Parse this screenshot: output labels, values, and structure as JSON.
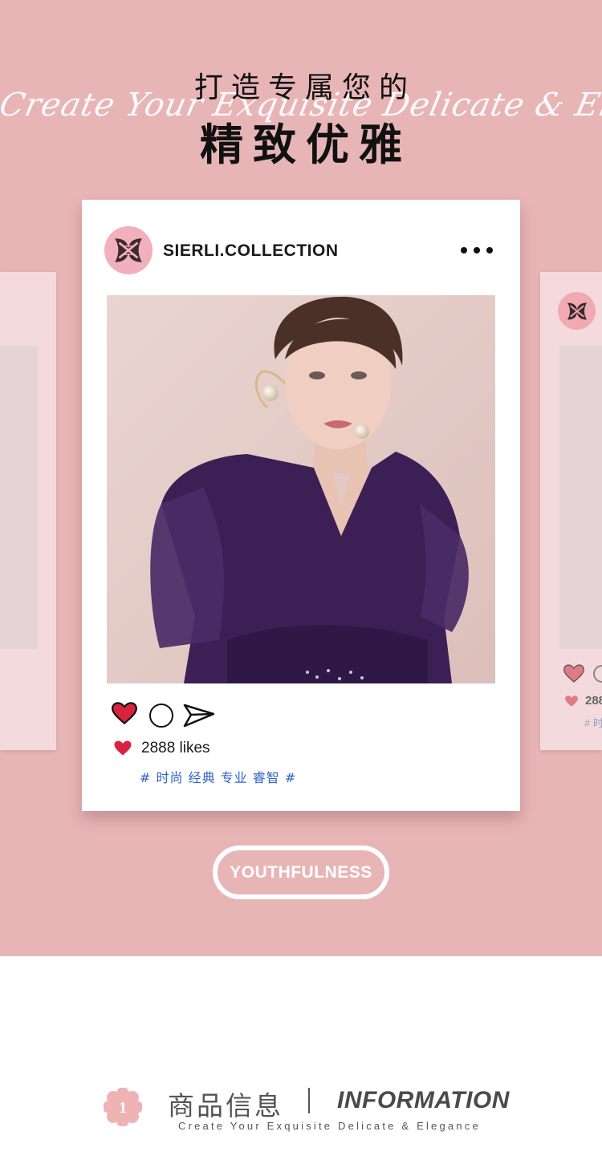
{
  "hero": {
    "script_text": "Create Your Exquisite Delicate & Elegance",
    "headline_line1": "打造专属您的",
    "headline_line2": "精致优雅"
  },
  "post": {
    "account_name": "SIERLI.COLLECTION",
    "likes_text": "2888 likes",
    "hashtags": "# 时尚 经典 专业 睿智 #",
    "actions": [
      "heart-icon",
      "comment-icon",
      "share-icon"
    ]
  },
  "side_cards": {
    "likes_text": "288",
    "tags_text": "# 时"
  },
  "badge_button": {
    "label": "YOUTHFULNESS"
  },
  "info_section": {
    "number": "1",
    "title_cn": "商品信息",
    "title_en": "INFORMATION",
    "subtitle": "Create Your Exquisite Delicate & Elegance"
  },
  "colors": {
    "background_pink": "#e8b5b7",
    "heart_red": "#d8233f",
    "hashtag_blue": "#2e64c4",
    "avatar_pink": "#f2b0bc",
    "dress_purple": "#3b1f55"
  }
}
